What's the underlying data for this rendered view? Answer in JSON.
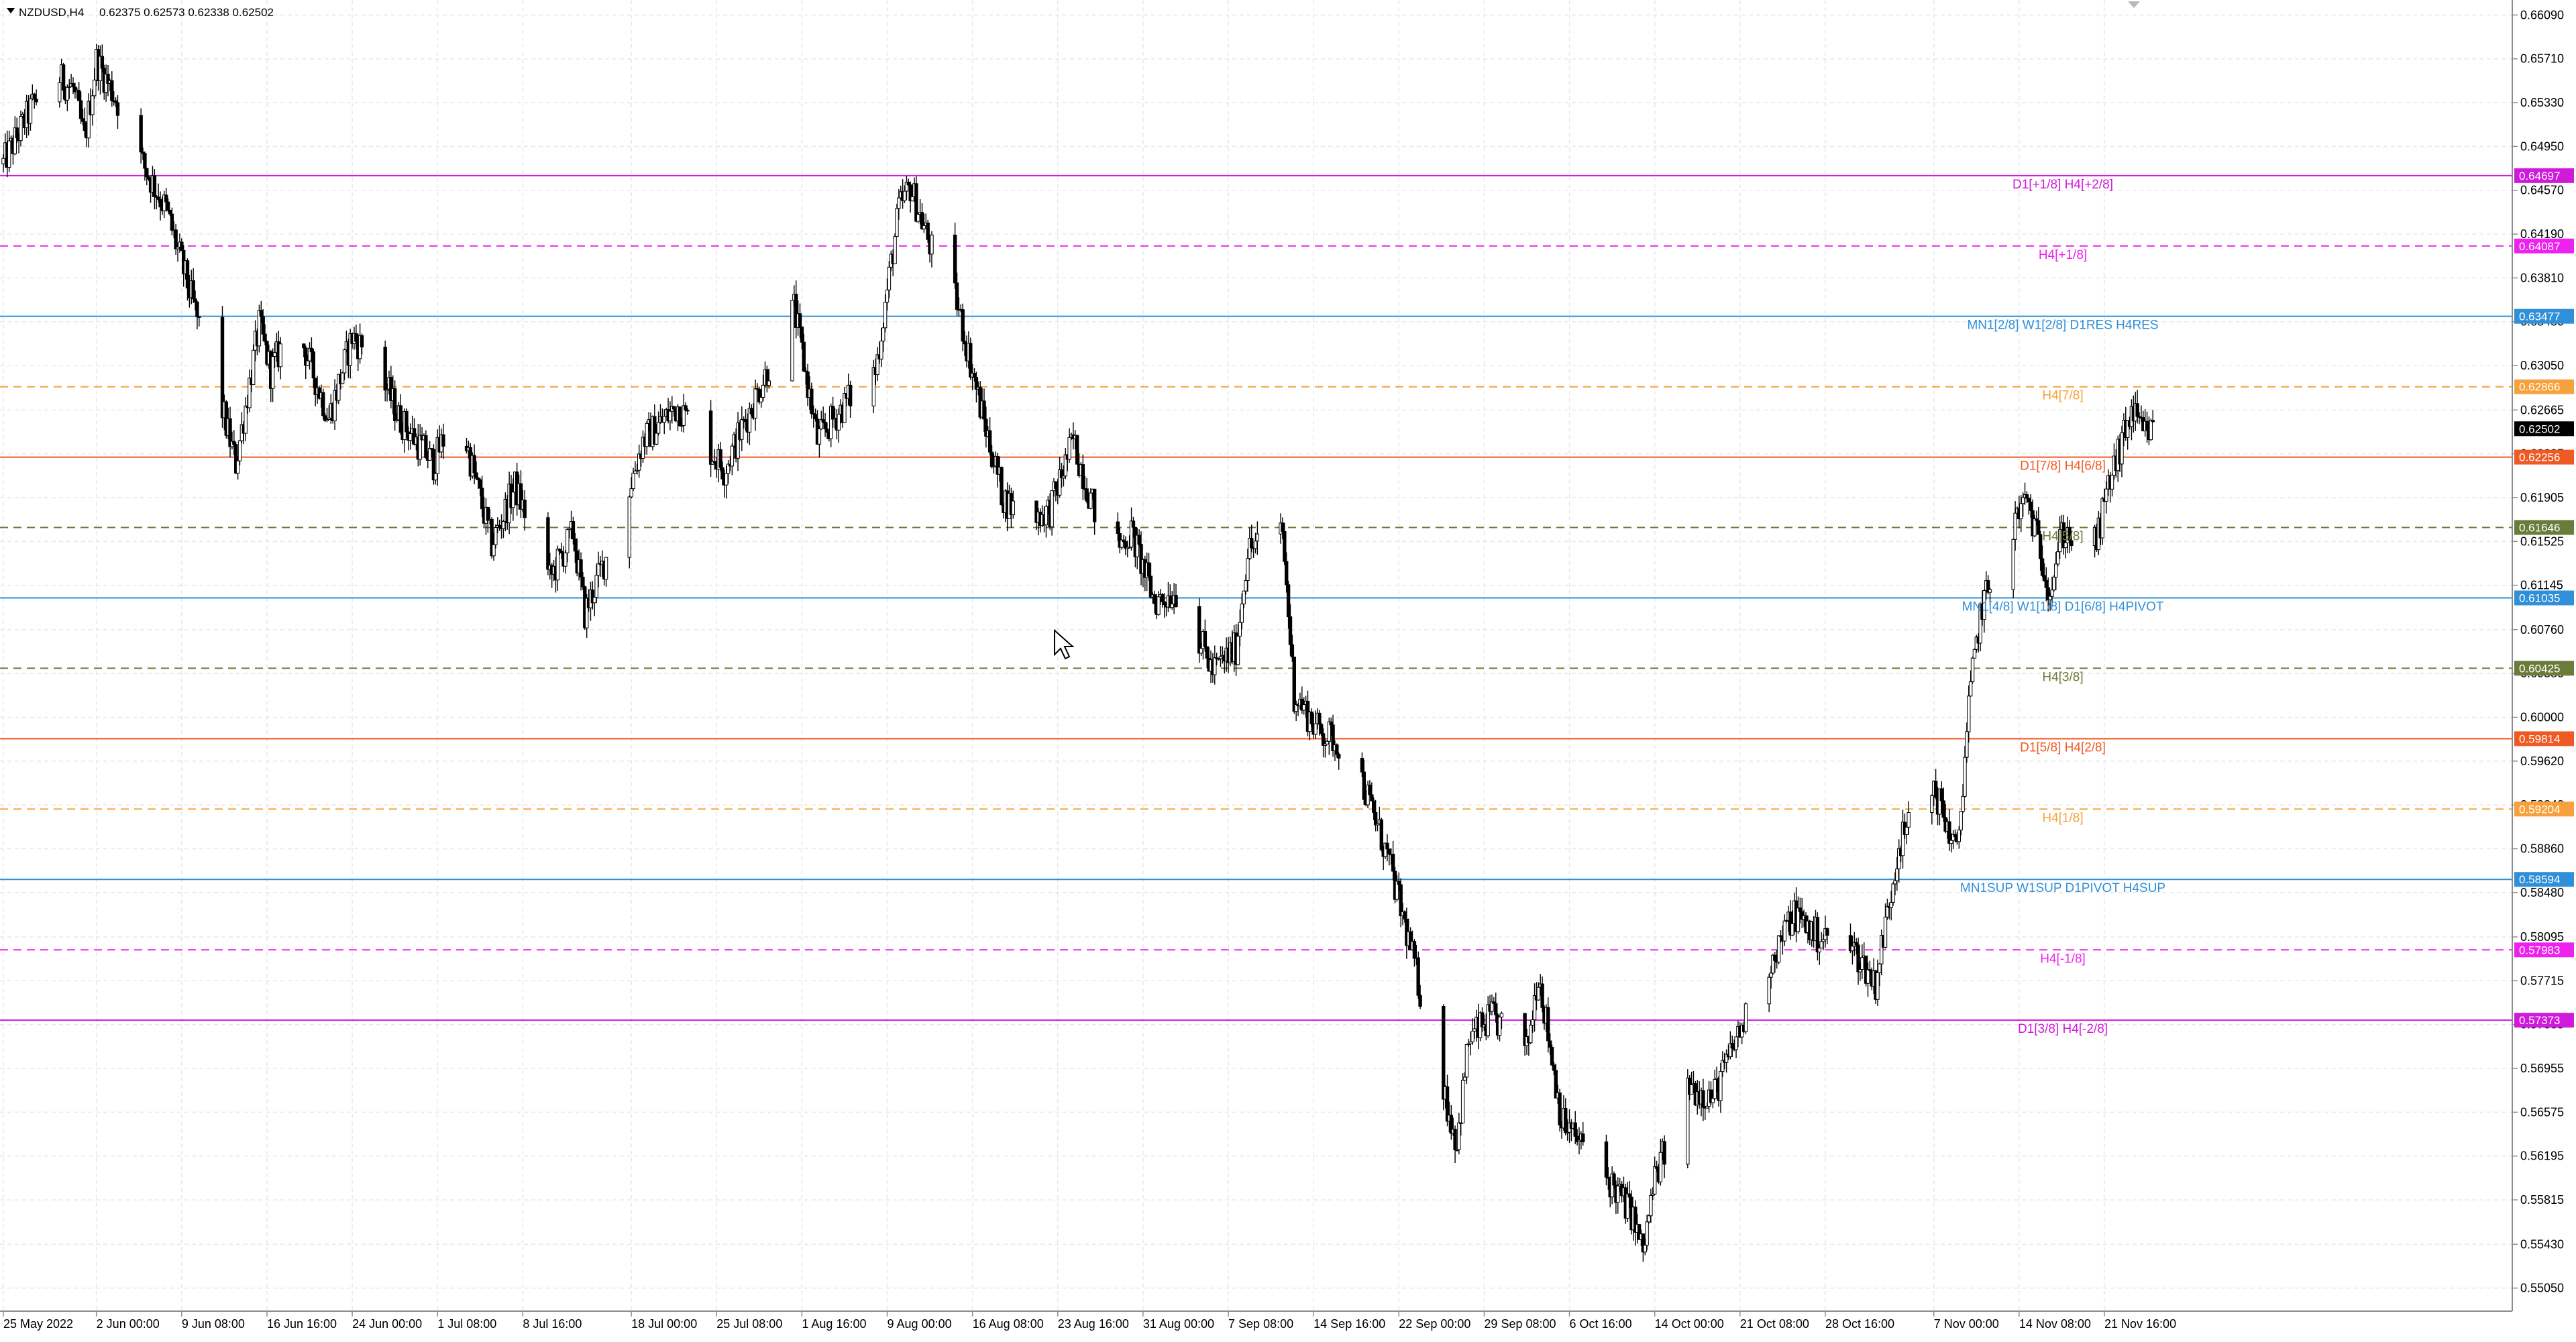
{
  "header": {
    "symbol": "NZDUSD,H4",
    "ohlc": "0.62375 0.62573 0.62338 0.62502"
  },
  "chart_data": {
    "type": "candlestick",
    "symbol": "NZDUSD",
    "timeframe": "H4",
    "ylim": [
      0.5485,
      0.6622
    ],
    "y_ticks": [
      "0.66090",
      "0.65710",
      "0.65330",
      "0.64950",
      "0.64570",
      "0.64190",
      "0.63810",
      "0.63430",
      "0.63050",
      "0.62665",
      "0.62285",
      "0.61905",
      "0.61525",
      "0.61145",
      "0.60760",
      "0.60380",
      "0.60000",
      "0.59620",
      "0.59240",
      "0.58860",
      "0.58480",
      "0.58095",
      "0.57715",
      "0.57335",
      "0.56955",
      "0.56575",
      "0.56195",
      "0.55815",
      "0.55430",
      "0.55050"
    ],
    "x_ticks": [
      "25 May 2022",
      "2 Jun 00:00",
      "9 Jun 08:00",
      "16 Jun 16:00",
      "24 Jun 00:00",
      "1 Jul 08:00",
      "8 Jul 16:00",
      "18 Jul 00:00",
      "25 Jul 08:00",
      "1 Aug 16:00",
      "9 Aug 00:00",
      "16 Aug 08:00",
      "23 Aug 16:00",
      "31 Aug 00:00",
      "7 Sep 08:00",
      "14 Sep 16:00",
      "22 Sep 00:00",
      "29 Sep 08:00",
      "6 Oct 16:00",
      "14 Oct 00:00",
      "21 Oct 08:00",
      "28 Oct 16:00",
      "7 Nov 00:00",
      "14 Nov 08:00",
      "21 Nov 16:00"
    ],
    "anchors": [
      [
        "25 May 2022",
        0.648
      ],
      [
        "29 May",
        0.656
      ],
      [
        "31 May",
        0.6545
      ],
      [
        "1 Jun",
        0.65
      ],
      [
        "2 Jun",
        0.657
      ],
      [
        "4 Jun",
        0.653
      ],
      [
        "6 Jun",
        0.648
      ],
      [
        "8 Jun",
        0.644
      ],
      [
        "10 Jun",
        0.637
      ],
      [
        "13 Jun",
        0.626
      ],
      [
        "14 Jun",
        0.622
      ],
      [
        "16 Jun",
        0.634
      ],
      [
        "17 Jun",
        0.63
      ],
      [
        "19 Jun",
        0.6345
      ],
      [
        "22 Jun",
        0.626
      ],
      [
        "24 Jun",
        0.633
      ],
      [
        "26 Jun",
        0.631
      ],
      [
        "28 Jun",
        0.626
      ],
      [
        "1 Jul",
        0.622
      ],
      [
        "3 Jul",
        0.627
      ],
      [
        "6 Jul",
        0.615
      ],
      [
        "8 Jul",
        0.62
      ],
      [
        "11 Jul",
        0.612
      ],
      [
        "13 Jul",
        0.616
      ],
      [
        "14 Jul",
        0.609
      ],
      [
        "17 Jul",
        0.617
      ],
      [
        "19 Jul",
        0.624
      ],
      [
        "22 Jul",
        0.627
      ],
      [
        "26 Jul",
        0.6215
      ],
      [
        "29 Jul",
        0.6285
      ],
      [
        "1 Aug",
        0.6355
      ],
      [
        "3 Aug",
        0.624
      ],
      [
        "6 Aug",
        0.628
      ],
      [
        "8 Aug",
        0.63
      ],
      [
        "10 Aug",
        0.644
      ],
      [
        "11 Aug",
        0.646
      ],
      [
        "13 Aug",
        0.64
      ],
      [
        "15 Aug",
        0.636
      ],
      [
        "17 Aug",
        0.627
      ],
      [
        "19 Aug",
        0.619
      ],
      [
        "21 Aug",
        0.617
      ],
      [
        "23 Aug",
        0.618
      ],
      [
        "25 Aug",
        0.624
      ],
      [
        "28 Aug",
        0.614
      ],
      [
        "30 Aug",
        0.616
      ],
      [
        "1 Sep",
        0.61
      ],
      [
        "3 Sep",
        0.611
      ],
      [
        "6 Sep",
        0.604
      ],
      [
        "8 Sep",
        0.606
      ],
      [
        "9 Sep",
        0.6145
      ],
      [
        "12 Sep",
        0.616
      ],
      [
        "13 Sep",
        0.602
      ],
      [
        "15 Sep",
        0.599
      ],
      [
        "18 Sep",
        0.597
      ],
      [
        "21 Sep",
        0.588
      ],
      [
        "23 Sep",
        0.58
      ],
      [
        "25 Sep",
        0.571
      ],
      [
        "27 Sep",
        0.563
      ],
      [
        "28 Sep",
        0.572
      ],
      [
        "30 Sep",
        0.574
      ],
      [
        "3 Oct",
        0.571
      ],
      [
        "4 Oct",
        0.578
      ],
      [
        "6 Oct",
        0.565
      ],
      [
        "10 Oct",
        0.56
      ],
      [
        "12 Oct",
        0.557
      ],
      [
        "13 Oct",
        0.5535
      ],
      [
        "14 Oct",
        0.56
      ],
      [
        "17 Oct",
        0.568
      ],
      [
        "19 Oct",
        0.567
      ],
      [
        "21 Oct",
        0.572
      ],
      [
        "24 Oct",
        0.579
      ],
      [
        "26 Oct",
        0.583
      ],
      [
        "28 Oct",
        0.581
      ],
      [
        "31 Oct",
        0.58
      ],
      [
        "2 Nov",
        0.577
      ],
      [
        "4 Nov",
        0.589
      ],
      [
        "7 Nov",
        0.594
      ],
      [
        "9 Nov",
        0.588
      ],
      [
        "10 Nov",
        0.601
      ],
      [
        "11 Nov",
        0.609
      ],
      [
        "13 Nov",
        0.615
      ],
      [
        "15 Nov",
        0.619
      ],
      [
        "17 Nov",
        0.611
      ],
      [
        "18 Nov",
        0.616
      ],
      [
        "21 Nov",
        0.615
      ],
      [
        "22 Nov",
        0.62
      ],
      [
        "24 Nov",
        0.6265
      ],
      [
        "25 Nov",
        0.6245
      ],
      [
        "26 Nov",
        0.625
      ]
    ],
    "levels": [
      {
        "value": 0.64697,
        "price": "0.64697",
        "label": "D1[+1/8] H4[+2/8]",
        "color": "#d01adb",
        "style": "solid"
      },
      {
        "value": 0.64087,
        "price": "0.64087",
        "label": "H4[+1/8]",
        "color": "#ee22ee",
        "style": "dashed"
      },
      {
        "value": 0.63477,
        "price": "0.63477",
        "label": "MN1[2/8] W1[2/8] D1RES H4RES",
        "color": "#2f8fd8",
        "style": "solid"
      },
      {
        "value": 0.62866,
        "price": "0.62866",
        "label": "H4[7/8]",
        "color": "#f7a13c",
        "style": "dashed"
      },
      {
        "value": 0.62256,
        "price": "0.62256",
        "label": "D1[7/8] H4[6/8]",
        "color": "#ee5a24",
        "style": "solid"
      },
      {
        "value": 0.61646,
        "price": "0.61646",
        "label": "H4[5/8]",
        "color": "#6b7b3a",
        "style": "dashed"
      },
      {
        "value": 0.61035,
        "price": "0.61035",
        "label": "MN1[4/8] W1[1/8] D1[6/8] H4PIVOT",
        "color": "#2f8fd8",
        "style": "solid"
      },
      {
        "value": 0.60425,
        "price": "0.60425",
        "label": "H4[3/8]",
        "color": "#6b7b3a",
        "style": "dashed"
      },
      {
        "value": 0.59814,
        "price": "0.59814",
        "label": "D1[5/8] H4[2/8]",
        "color": "#ee5a24",
        "style": "solid"
      },
      {
        "value": 0.59204,
        "price": "0.59204",
        "label": "H4[1/8]",
        "color": "#f7a13c",
        "style": "dashed"
      },
      {
        "value": 0.58594,
        "price": "0.58594",
        "label": "MN1SUP W1SUP D1PIVOT H4SUP",
        "color": "#2f8fd8",
        "style": "solid"
      },
      {
        "value": 0.57983,
        "price": "0.57983",
        "label": "H4[-1/8]",
        "color": "#ee22ee",
        "style": "dashed"
      },
      {
        "value": 0.57373,
        "price": "0.57373",
        "label": "D1[3/8] H4[-2/8]",
        "color": "#d01adb",
        "style": "solid"
      }
    ],
    "current_price": {
      "value": 0.62502,
      "price": "0.62502"
    },
    "grid": true,
    "colors": {
      "background": "#ffffff",
      "grid": "#e8e8e8",
      "candle": "#000000",
      "axis": "#8c8c8c"
    }
  }
}
